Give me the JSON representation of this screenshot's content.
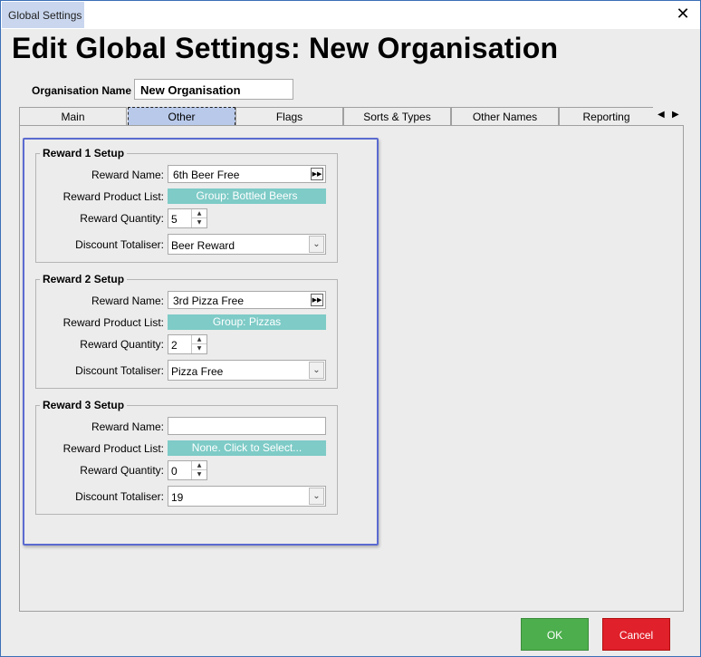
{
  "window": {
    "title": "Global Settings",
    "close_glyph": "✕"
  },
  "heading": "Edit Global Settings: New Organisation",
  "organisation": {
    "label": "Organisation Name",
    "value": "New Organisation"
  },
  "tabs": [
    {
      "label": "Main"
    },
    {
      "label": "Other"
    },
    {
      "label": "Flags"
    },
    {
      "label": "Sorts & Types"
    },
    {
      "label": "Other Names"
    },
    {
      "label": "Reporting"
    }
  ],
  "active_tab": "Other",
  "tab_scroll": {
    "left": "◀",
    "right": "▶"
  },
  "rewards": [
    {
      "title": "Reward 1 Setup",
      "name_label": "Reward Name:",
      "name_value": "6th Beer Free",
      "product_label": "Reward Product List:",
      "product_value": "Group: Bottled Beers",
      "quantity_label": "Reward Quantity:",
      "quantity_value": "5",
      "totaliser_label": "Discount Totaliser:",
      "totaliser_value": "Beer Reward"
    },
    {
      "title": "Reward 2 Setup",
      "name_label": "Reward Name:",
      "name_value": "3rd Pizza Free",
      "product_label": "Reward Product List:",
      "product_value": "Group: Pizzas",
      "quantity_label": "Reward Quantity:",
      "quantity_value": "2",
      "totaliser_label": "Discount Totaliser:",
      "totaliser_value": "Pizza Free"
    },
    {
      "title": "Reward 3 Setup",
      "name_label": "Reward Name:",
      "name_value": "",
      "product_label": "Reward Product List:",
      "product_value": "None. Click to Select...",
      "quantity_label": "Reward Quantity:",
      "quantity_value": "0",
      "totaliser_label": "Discount Totaliser:",
      "totaliser_value": "19"
    }
  ],
  "glyphs": {
    "fast_forward": "▶▶",
    "spin_up": "▲",
    "spin_down": "▼",
    "dropdown": "⌄"
  },
  "buttons": {
    "ok": "OK",
    "cancel": "Cancel"
  },
  "colors": {
    "product_button": "#7ecbc7",
    "ok_button": "#4cae4c",
    "cancel_button": "#e0202a",
    "highlight_frame": "#5b6bd0",
    "active_tab": "#b9c9ea"
  }
}
